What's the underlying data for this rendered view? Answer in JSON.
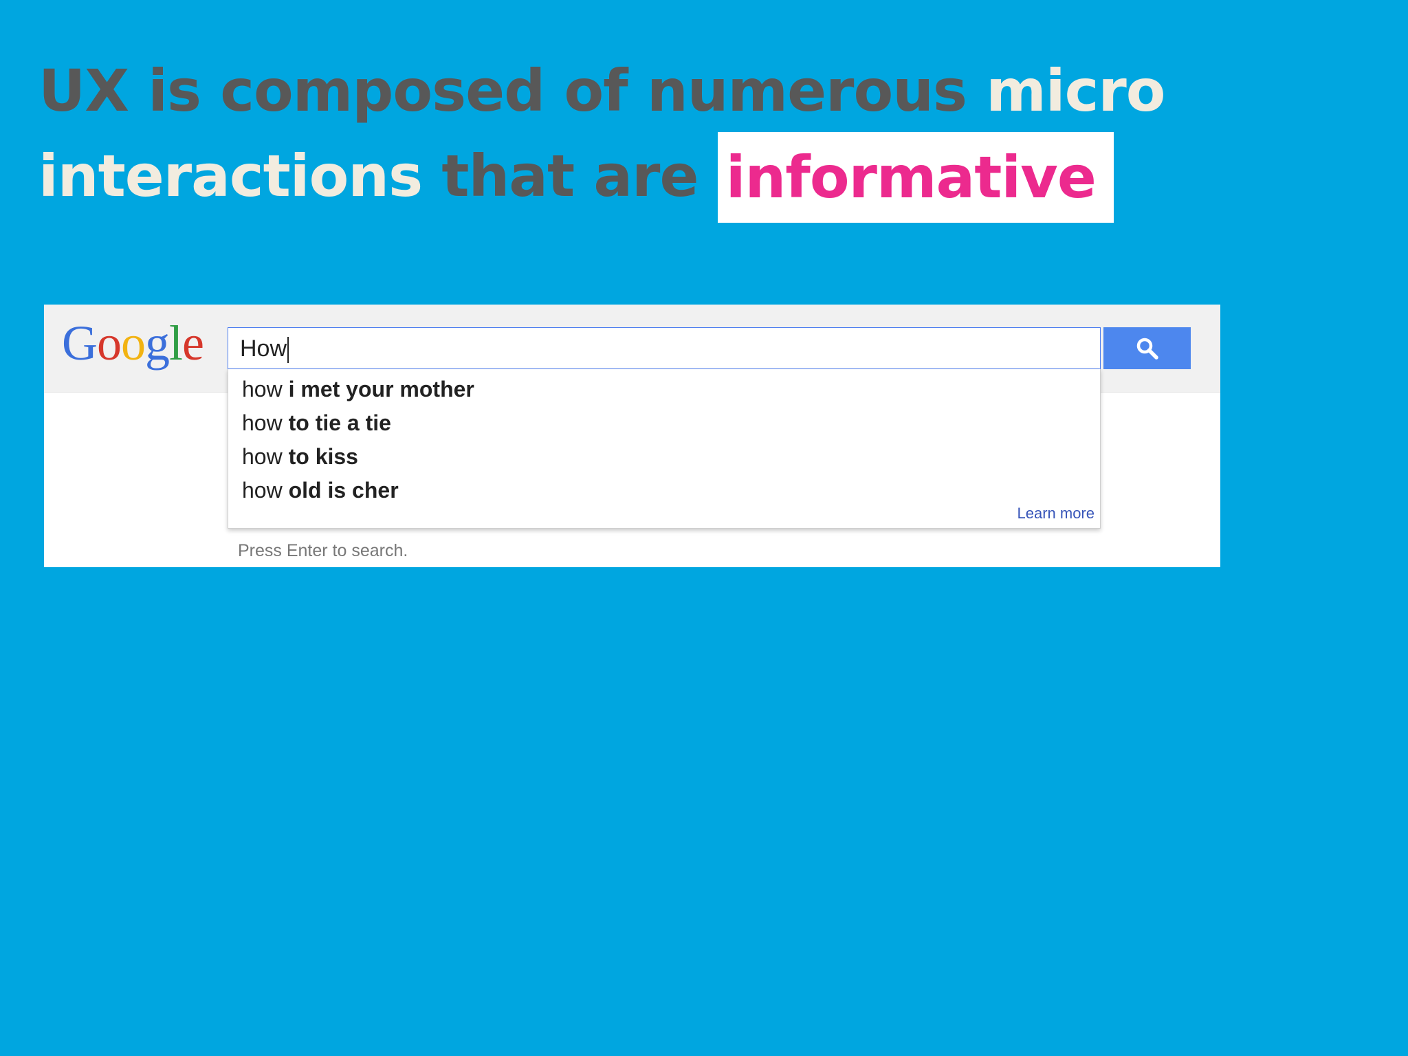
{
  "heading": {
    "line1_dark": "UX is composed of numerous ",
    "line1_light": "micro",
    "line2_light": "interactions ",
    "line2_dark": "that are ",
    "line2_highlight": "informative"
  },
  "colors": {
    "background": "#00a6e0",
    "heading_dark": "#585858",
    "heading_light": "#f2ecdf",
    "highlight_text": "#ec2a8e",
    "search_button": "#4d87ee"
  },
  "google": {
    "logo_letters": [
      "G",
      "o",
      "o",
      "g",
      "l",
      "e"
    ],
    "logo_colors": [
      "#3b6fdb",
      "#d6372b",
      "#f2b312",
      "#3b6fdb",
      "#2f9d44",
      "#d6372b"
    ],
    "search_value": "How",
    "mic_icon": "microphone-icon",
    "search_icon": "magnifier-icon",
    "suggestions": [
      {
        "prefix": "how ",
        "completion": "i met your mother"
      },
      {
        "prefix": "how ",
        "completion": "to tie a tie"
      },
      {
        "prefix": "how ",
        "completion": "to kiss"
      },
      {
        "prefix": "how ",
        "completion": "old is cher"
      }
    ],
    "learn_more": "Learn more",
    "press_enter": "Press Enter to search."
  }
}
